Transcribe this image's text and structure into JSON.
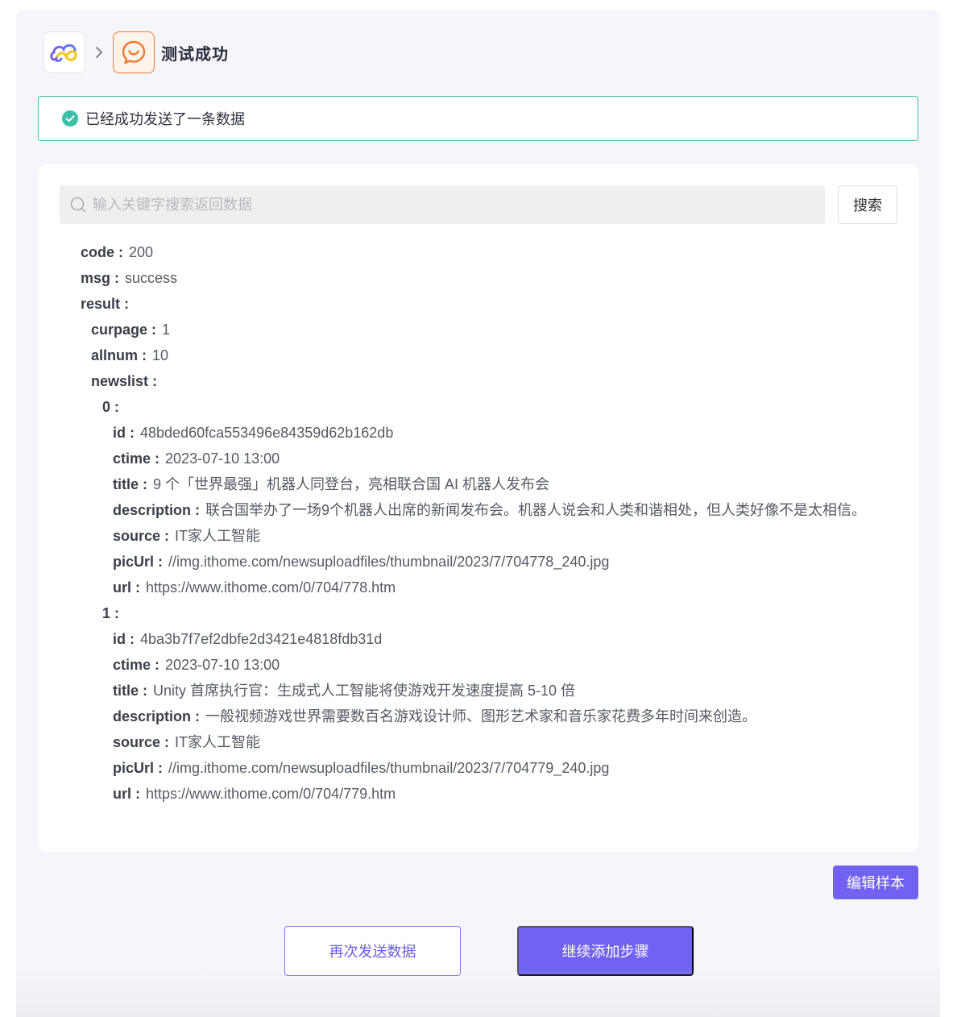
{
  "breadcrumb": {
    "source_icon": "cloud-icon",
    "separator_icon": "chevron-right-icon",
    "target_icon": "chat-bubble-icon",
    "title": "测试成功"
  },
  "alert": {
    "icon": "check-circle-icon",
    "message": "已经成功发送了一条数据",
    "color": "#3dbfa8"
  },
  "search": {
    "placeholder": "输入关键字搜索返回数据",
    "value": "",
    "button_label": "搜索"
  },
  "result_tree": [
    {
      "level": 0,
      "key": "code",
      "value": "200"
    },
    {
      "level": 0,
      "key": "msg",
      "value": "success"
    },
    {
      "level": 0,
      "key": "result",
      "value": ""
    },
    {
      "level": 1,
      "key": "curpage",
      "value": "1"
    },
    {
      "level": 1,
      "key": "allnum",
      "value": "10"
    },
    {
      "level": 1,
      "key": "newslist",
      "value": ""
    },
    {
      "level": 2,
      "key": "0",
      "value": ""
    },
    {
      "level": 3,
      "key": "id",
      "value": "48bded60fca553496e84359d62b162db"
    },
    {
      "level": 3,
      "key": "ctime",
      "value": "2023-07-10 13:00"
    },
    {
      "level": 3,
      "key": "title",
      "value": "9 个「世界最强」机器人同登台，亮相联合国 AI 机器人发布会"
    },
    {
      "level": 3,
      "key": "description",
      "value": "联合国举办了一场9个机器人出席的新闻发布会。机器人说会和人类和谐相处，但人类好像不是太相信。"
    },
    {
      "level": 3,
      "key": "source",
      "value": "IT家人工智能"
    },
    {
      "level": 3,
      "key": "picUrl",
      "value": "//img.ithome.com/newsuploadfiles/thumbnail/2023/7/704778_240.jpg"
    },
    {
      "level": 3,
      "key": "url",
      "value": "https://www.ithome.com/0/704/778.htm"
    },
    {
      "level": 2,
      "key": "1",
      "value": ""
    },
    {
      "level": 3,
      "key": "id",
      "value": "4ba3b7f7ef2dbfe2d3421e4818fdb31d"
    },
    {
      "level": 3,
      "key": "ctime",
      "value": "2023-07-10 13:00"
    },
    {
      "level": 3,
      "key": "title",
      "value": "Unity 首席执行官：生成式人工智能将使游戏开发速度提高 5-10 倍"
    },
    {
      "level": 3,
      "key": "description",
      "value": "一般视频游戏世界需要数百名游戏设计师、图形艺术家和音乐家花费多年时间来创造。"
    },
    {
      "level": 3,
      "key": "source",
      "value": "IT家人工智能"
    },
    {
      "level": 3,
      "key": "picUrl",
      "value": "//img.ithome.com/newsuploadfiles/thumbnail/2023/7/704779_240.jpg"
    },
    {
      "level": 3,
      "key": "url",
      "value": "https://www.ithome.com/0/704/779.htm"
    }
  ],
  "actions": {
    "edit_sample": "编辑样本",
    "resend": "再次发送数据",
    "continue": "继续添加步骤"
  },
  "colors": {
    "accent": "#7162f2",
    "success": "#3dbfa8",
    "app_orange": "#f07a2c"
  }
}
